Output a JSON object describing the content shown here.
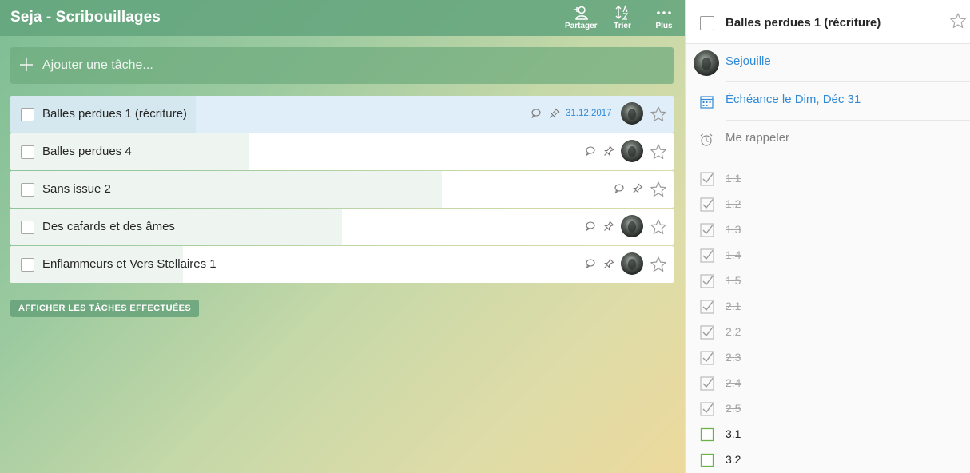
{
  "header": {
    "title": "Seja - Scribouillages",
    "share_label": "Partager",
    "sort_label": "Trier",
    "more_label": "Plus"
  },
  "add_task": {
    "placeholder": "Ajouter une tâche..."
  },
  "tasks": [
    {
      "title": "Balles perdues 1 (récriture)",
      "due": "31.12.2017",
      "selected": true
    },
    {
      "title": "Balles perdues 4",
      "due": "",
      "selected": false
    },
    {
      "title": "Sans issue 2",
      "due": "",
      "selected": false
    },
    {
      "title": "Des cafards et des âmes",
      "due": "",
      "selected": false
    },
    {
      "title": "Enflammeurs et Vers Stellaires 1",
      "due": "",
      "selected": false
    }
  ],
  "show_done_label": "AFFICHER LES TÂCHES EFFECTUÉES",
  "detail": {
    "title": "Balles perdues 1 (récriture)",
    "assignee": "Sejouille",
    "due_label": "Échéance le Dim, Déc 31",
    "reminder_label": "Me rappeler",
    "subtasks": [
      {
        "label": "1.1",
        "done": true
      },
      {
        "label": "1.2",
        "done": true
      },
      {
        "label": "1.3",
        "done": true
      },
      {
        "label": "1.4",
        "done": true
      },
      {
        "label": "1.5",
        "done": true
      },
      {
        "label": "2.1",
        "done": true
      },
      {
        "label": "2.2",
        "done": true
      },
      {
        "label": "2.3",
        "done": true
      },
      {
        "label": "2.4",
        "done": true
      },
      {
        "label": "2.5",
        "done": true
      },
      {
        "label": "3.1",
        "done": false
      },
      {
        "label": "3.2",
        "done": false
      }
    ]
  },
  "colors": {
    "accent_blue": "#328ad6",
    "header_green": "#64a57d",
    "subtask_open_green": "#6cb24a"
  }
}
